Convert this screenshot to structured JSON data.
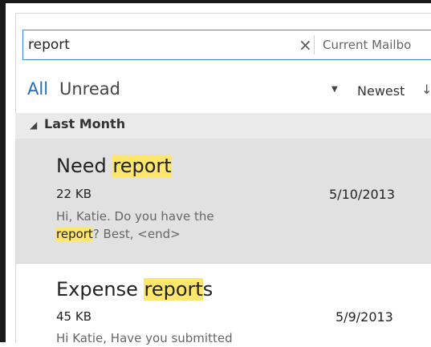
{
  "search": {
    "query": "report",
    "clear_icon": "×",
    "scope_label": "Current Mailbo"
  },
  "filters": {
    "all_label": "All",
    "unread_label": "Unread",
    "sort_label": "Newest",
    "sort_arrow": "↓"
  },
  "group": {
    "label": "Last Month"
  },
  "messages": [
    {
      "subject_before": "Need ",
      "subject_hl": "report",
      "subject_after": "",
      "size": "22 KB",
      "date": "5/10/2013",
      "preview_line1": "Hi, Katie. Do you have the",
      "preview_hl": "report",
      "preview_line2": "? Best, <end>"
    },
    {
      "subject_before": "Expense ",
      "subject_hl": "report",
      "subject_after": "s",
      "size": "45 KB",
      "date": "5/9/2013",
      "preview_line1": "Hi Katie, Have you submitted"
    }
  ],
  "colors": {
    "accent": "#1f6ebc",
    "highlight": "#fde66b",
    "selected_row": "#e1e1e1"
  }
}
